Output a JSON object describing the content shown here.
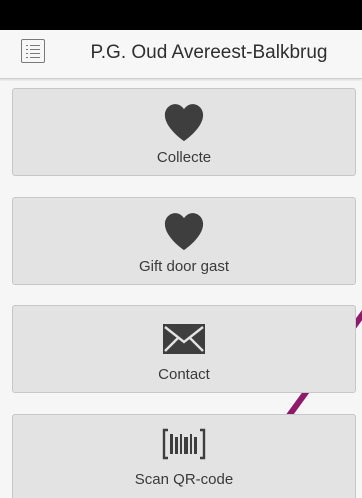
{
  "header": {
    "title": "P.G. Oud Avereest-Balkbrug",
    "menu_icon": "list-menu-icon"
  },
  "tiles": [
    {
      "label": "Collecte",
      "icon": "heart-icon"
    },
    {
      "label": "Gift door gast",
      "icon": "heart-icon"
    },
    {
      "label": "Contact",
      "icon": "envelope-icon"
    },
    {
      "label": "Scan QR-code",
      "icon": "barcode-icon"
    }
  ],
  "colors": {
    "accent": "#8e1a6b",
    "tile_background": "#e3e3e3",
    "icon": "#3e3e3e"
  }
}
